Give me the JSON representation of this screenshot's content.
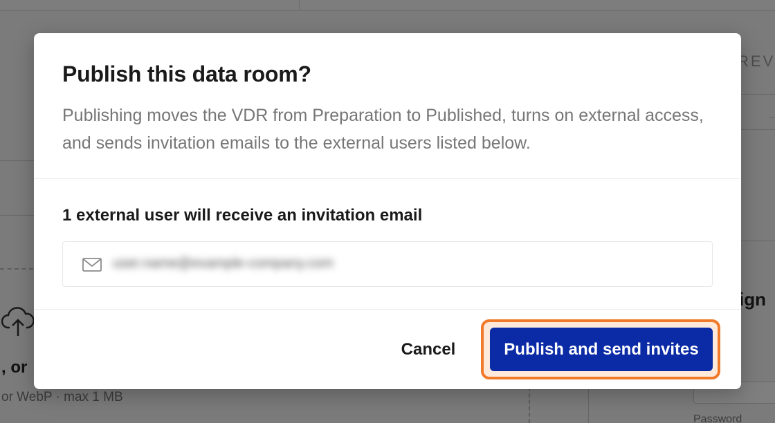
{
  "background": {
    "right_header": "REVI",
    "upload_prompt": ", or",
    "file_hint": "or WebP · max 1 MB",
    "sign_heading": "ign",
    "password_label": "Password"
  },
  "modal": {
    "title": "Publish this data room?",
    "description": "Publishing moves the VDR from Preparation to Published, turns on external access, and sends invitation emails to the external users listed below.",
    "recipients_heading": "1 external user will receive an invitation email",
    "recipients": [
      {
        "email": "user.name@example-company.com",
        "icon": "mail-icon",
        "blurred": true
      }
    ],
    "cancel_label": "Cancel",
    "publish_label": "Publish and send invites",
    "colors": {
      "primary": "#0a2aa6",
      "highlight_ring": "#f07a2a",
      "overlay": "rgba(0,0,0,0.5)"
    }
  }
}
